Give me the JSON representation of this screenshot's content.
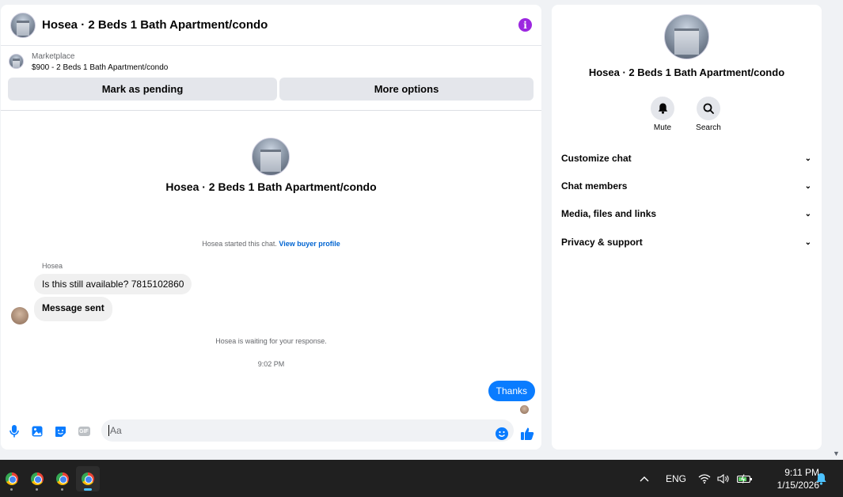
{
  "chat": {
    "title": "Hosea · 2 Beds 1 Bath Apartment/condo",
    "listing": {
      "source": "Marketplace",
      "description": "$900 - 2 Beds 1 Bath Apartment/condo"
    },
    "buttons": {
      "mark_pending": "Mark as pending",
      "more_options": "More options"
    },
    "thread": {
      "title": "Hosea · 2 Beds 1 Bath Apartment/condo",
      "started_text": "Hosea started this chat.",
      "view_buyer_profile": "View buyer profile",
      "sender_name": "Hosea",
      "messages_in": [
        "Is this still available? 7815102860",
        "Message sent"
      ],
      "waiting_text": "Hosea is waiting for your response.",
      "timestamp": "9:02 PM",
      "message_out": "Thanks"
    },
    "composer": {
      "placeholder": "Aa",
      "gif_label": "GIF"
    }
  },
  "info_panel": {
    "title": "Hosea · 2 Beds 1 Bath Apartment/condo",
    "actions": [
      {
        "label": "Mute",
        "icon": "bell-icon"
      },
      {
        "label": "Search",
        "icon": "search-icon"
      }
    ],
    "sections": [
      "Customize chat",
      "Chat members",
      "Media, files and links",
      "Privacy & support"
    ]
  },
  "taskbar": {
    "language": "ENG",
    "time": "9:11 PM",
    "date": "1/15/2026"
  },
  "colors": {
    "messenger_blue": "#0a7cff",
    "info_purple": "#9c27e0",
    "link_blue": "#0064d1"
  }
}
